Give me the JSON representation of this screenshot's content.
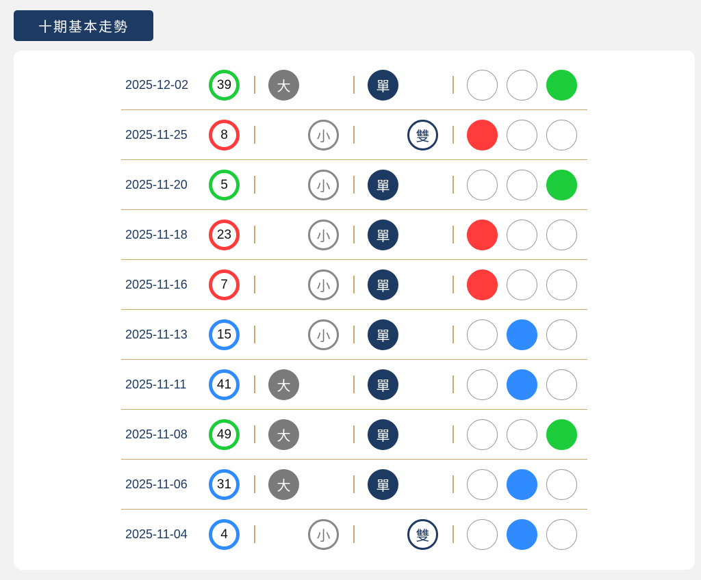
{
  "title": "十期基本走勢",
  "labels": {
    "big": "大",
    "small": "小",
    "odd": "單",
    "even": "雙"
  },
  "colors": {
    "red": "#ff3b3b",
    "green": "#1ccc3a",
    "blue": "#2f8bff",
    "navy": "#1d3a63",
    "gold": "#c9a86a"
  },
  "rows": [
    {
      "date": "2025-12-02",
      "number": "39",
      "color": "green",
      "size": "big",
      "parity": "odd"
    },
    {
      "date": "2025-11-25",
      "number": "8",
      "color": "red",
      "size": "small",
      "parity": "even"
    },
    {
      "date": "2025-11-20",
      "number": "5",
      "color": "green",
      "size": "small",
      "parity": "odd"
    },
    {
      "date": "2025-11-18",
      "number": "23",
      "color": "red",
      "size": "small",
      "parity": "odd"
    },
    {
      "date": "2025-11-16",
      "number": "7",
      "color": "red",
      "size": "small",
      "parity": "odd"
    },
    {
      "date": "2025-11-13",
      "number": "15",
      "color": "blue",
      "size": "small",
      "parity": "odd"
    },
    {
      "date": "2025-11-11",
      "number": "41",
      "color": "blue",
      "size": "big",
      "parity": "odd"
    },
    {
      "date": "2025-11-08",
      "number": "49",
      "color": "green",
      "size": "big",
      "parity": "odd"
    },
    {
      "date": "2025-11-06",
      "number": "31",
      "color": "blue",
      "size": "big",
      "parity": "odd"
    },
    {
      "date": "2025-11-04",
      "number": "4",
      "color": "blue",
      "size": "small",
      "parity": "even"
    }
  ]
}
